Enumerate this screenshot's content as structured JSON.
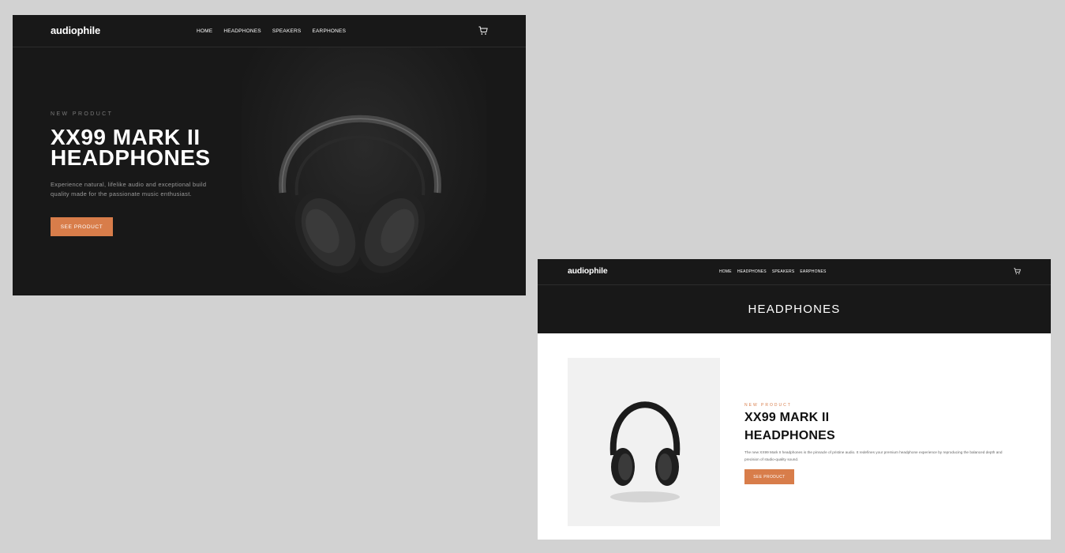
{
  "hero_page": {
    "logo": "audiophile",
    "nav": [
      "HOME",
      "HEADPHONES",
      "SPEAKERS",
      "EARPHONES"
    ],
    "cart_icon": "cart-icon",
    "overline": "NEW PRODUCT",
    "title": "XX99 MARK II HEADPHONES",
    "description": "Experience natural, lifelike audio and exceptional build quality made for the passionate music enthusiast.",
    "button": "SEE PRODUCT"
  },
  "category_page": {
    "logo": "audiophile",
    "nav": [
      "HOME",
      "HEADPHONES",
      "SPEAKERS",
      "EARPHONES"
    ],
    "cart_icon": "cart-icon",
    "category_title": "HEADPHONES",
    "product": {
      "overline": "NEW PRODUCT",
      "title": "XX99 MARK II HEADPHONES",
      "description": "The new XX99 Mark II headphones is the pinnacle of pristine audio. It redefines your premium headphone experience by reproducing the balanced depth and precision of studio-quality sound.",
      "button": "SEE PRODUCT"
    }
  },
  "colors": {
    "accent": "#d87d4a",
    "dark": "#181818",
    "background": "#d2d2d2"
  }
}
